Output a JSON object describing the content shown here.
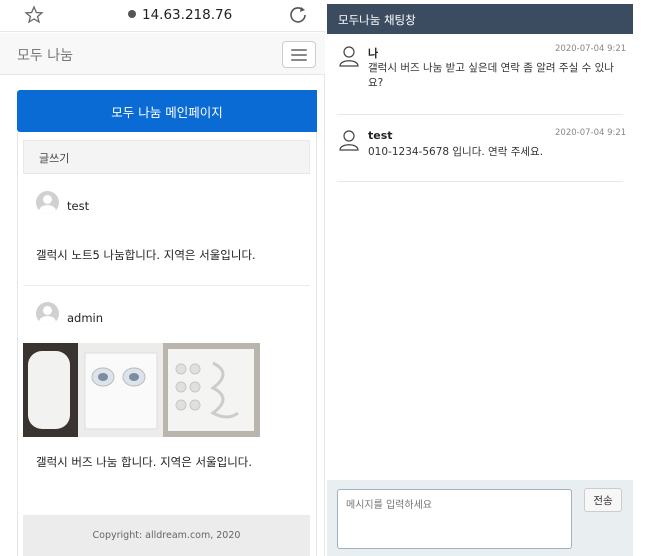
{
  "browser": {
    "url": "14.63.218.76"
  },
  "site": {
    "brand": "모두 나눔",
    "main_button": "모두 나눔 메인페이지",
    "write_label": "글쓰기",
    "footer": "Copyright: alldream.com, 2020"
  },
  "posts": [
    {
      "author": "test",
      "text": "갤럭시 노트5 나눔합니다. 지역은 서울입니다."
    },
    {
      "author": "admin",
      "text": "갤럭시 버즈 나눔 합니다. 지역은 서울입니다."
    }
  ],
  "chat": {
    "title": "모두나눔 채팅창",
    "messages": [
      {
        "sender": "나",
        "time": "2020-07-04 9:21",
        "text": "갤럭시 버즈 나눔 받고 싶은데 연락 좀 알려 주실 수 있나요?"
      },
      {
        "sender": "test",
        "time": "2020-07-04 9:21",
        "text": "010-1234-5678 입니다. 연락 주세요."
      }
    ],
    "input_placeholder": "메시지를 입력하세요",
    "send_label": "전송"
  },
  "colors": {
    "primary_button": "#0a6bd4",
    "chat_header": "#3b4c60"
  }
}
